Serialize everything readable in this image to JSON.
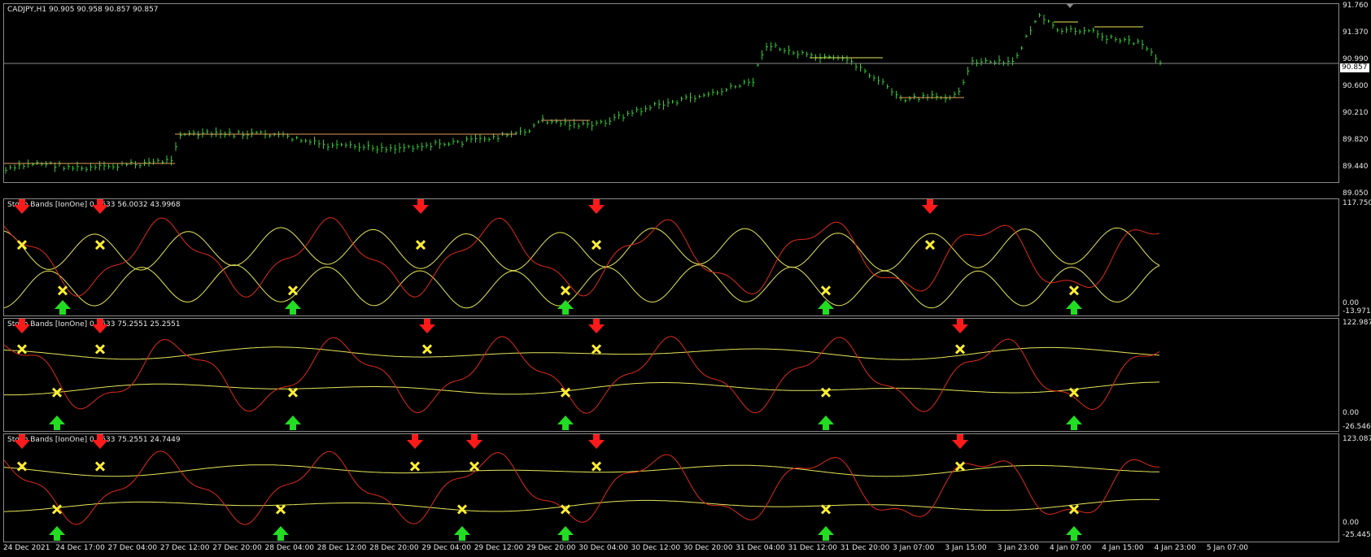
{
  "symbol_header": "CADJPY,H1  90.905 90.958 90.857 90.857",
  "price_scale": [
    "91.760",
    "91.370",
    "90.990",
    "90.600",
    "90.210",
    "89.820",
    "89.440",
    "89.050"
  ],
  "current_price": "90.857",
  "indicator_panes": [
    {
      "label": "Stoch Bands [IonOne] 0.3633 56.0032 43.9968",
      "scale_top": "117.7505",
      "scale_zero": "0.00",
      "scale_bottom": "-13.9719"
    },
    {
      "label": "Stoch Bands [IonOne] 0.3633 75.2551 25.2551",
      "scale_top": "122.9875",
      "scale_zero": "0.00",
      "scale_bottom": "-26.5468"
    },
    {
      "label": "Stoch Bands [IonOne] 0.3633 75.2551 24.7449",
      "scale_top": "123.0871",
      "scale_zero": "0.00",
      "scale_bottom": "-25.4455"
    }
  ],
  "time_axis": [
    "24 Dec 2021",
    "24 Dec 17:00",
    "27 Dec 04:00",
    "27 Dec 12:00",
    "27 Dec 20:00",
    "28 Dec 04:00",
    "28 Dec 12:00",
    "28 Dec 20:00",
    "29 Dec 04:00",
    "29 Dec 12:00",
    "29 Dec 20:00",
    "30 Dec 04:00",
    "30 Dec 12:00",
    "30 Dec 20:00",
    "31 Dec 04:00",
    "31 Dec 12:00",
    "31 Dec 20:00",
    "3 Jan 07:00",
    "3 Jan 15:00",
    "3 Jan 23:00",
    "4 Jan 07:00",
    "4 Jan 15:00",
    "4 Jan 23:00",
    "5 Jan 07:00"
  ],
  "colors": {
    "bars": "#33cc33",
    "bands": "#e6e65a",
    "stoch": "#dd2b1c",
    "sell_arrow": "#ff1a1a",
    "buy_arrow": "#22dd22",
    "cross": "#ffee33",
    "grid_line": "#8a8a8a"
  },
  "icons": [
    "sell-arrow-icon",
    "buy-arrow-icon",
    "cross-signal-icon",
    "window-arrow-icon"
  ]
}
